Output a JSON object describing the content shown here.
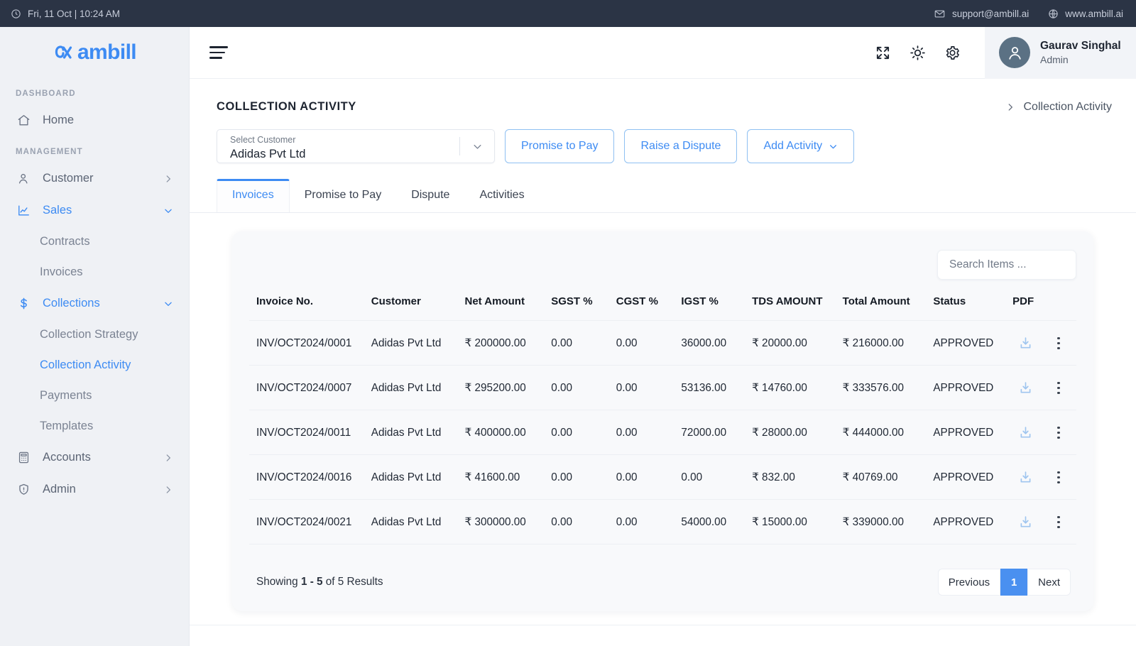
{
  "topbar": {
    "clock_icon": "clock-icon",
    "datetime": "Fri, 11 Oct | 10:24 AM",
    "email_icon": "mail-icon",
    "email": "support@ambill.ai",
    "globe_icon": "globe-icon",
    "website": "www.ambill.ai"
  },
  "brand": {
    "logo_text": "ambill",
    "logo_color": "#3d8bf3"
  },
  "sidebar": {
    "sections": [
      {
        "label": "DASHBOARD"
      },
      {
        "label": "MANAGEMENT"
      }
    ],
    "dashboard_items": [
      {
        "label": "Home",
        "icon": "home-icon",
        "active": false,
        "chevron": ""
      }
    ],
    "management_items": [
      {
        "label": "Customer",
        "icon": "users-icon",
        "active": false,
        "chevron": "chevron-right-icon"
      },
      {
        "label": "Sales",
        "icon": "chart-line-icon",
        "active": true,
        "chevron": "chevron-down-icon"
      },
      {
        "label": "Contracts",
        "sub": true,
        "active": false
      },
      {
        "label": "Invoices",
        "sub": true,
        "active": false
      },
      {
        "label": "Collections",
        "icon": "dollar-icon",
        "active": true,
        "chevron": "chevron-down-icon"
      },
      {
        "label": "Collection Strategy",
        "sub": true,
        "active": false
      },
      {
        "label": "Collection Activity",
        "sub": true,
        "active": true
      },
      {
        "label": "Payments",
        "sub": true,
        "active": false
      },
      {
        "label": "Templates",
        "sub": true,
        "active": false
      },
      {
        "label": "Accounts",
        "icon": "calculator-icon",
        "active": false,
        "chevron": "chevron-right-icon"
      },
      {
        "label": "Admin",
        "icon": "shield-icon",
        "active": false,
        "chevron": "chevron-right-icon"
      }
    ]
  },
  "appbar": {
    "menu_icon": "hamburger-icon",
    "fullscreen_icon": "expand-icon",
    "theme_icon": "sun-icon",
    "settings_icon": "gear-icon",
    "avatar_icon": "user-avatar-icon",
    "user_name": "Gaurav Singhal",
    "user_role": "Admin"
  },
  "page": {
    "title": "COLLECTION ACTIVITY",
    "breadcrumb_icon": "chevron-right-icon",
    "breadcrumb": "Collection Activity"
  },
  "controls": {
    "select_label": "Select Customer",
    "select_value": "Adidas Pvt Ltd",
    "select_caret_icon": "chevron-down-icon",
    "buttons": [
      {
        "label": "Promise to Pay",
        "caret": false
      },
      {
        "label": "Raise a Dispute",
        "caret": false
      },
      {
        "label": "Add Activity",
        "caret": true
      }
    ]
  },
  "tabs": [
    {
      "label": "Invoices",
      "active": true
    },
    {
      "label": "Promise to Pay",
      "active": false
    },
    {
      "label": "Dispute",
      "active": false
    },
    {
      "label": "Activities",
      "active": false
    }
  ],
  "table": {
    "search_placeholder": "Search Items ...",
    "columns": [
      "Invoice No.",
      "Customer",
      "Net Amount",
      "SGST %",
      "CGST %",
      "IGST %",
      "TDS AMOUNT",
      "Total Amount",
      "Status",
      "PDF"
    ],
    "rows": [
      {
        "invoice_no": "INV/OCT2024/0001",
        "customer": "Adidas Pvt Ltd",
        "net_amount": "₹ 200000.00",
        "sgst": "0.00",
        "cgst": "0.00",
        "igst": "36000.00",
        "tds_amount": "₹ 20000.00",
        "total_amount": "₹ 216000.00",
        "status": "APPROVED",
        "download_icon": "download-icon",
        "menu_icon": "kebab-menu-icon"
      },
      {
        "invoice_no": "INV/OCT2024/0007",
        "customer": "Adidas Pvt Ltd",
        "net_amount": "₹ 295200.00",
        "sgst": "0.00",
        "cgst": "0.00",
        "igst": "53136.00",
        "tds_amount": "₹ 14760.00",
        "total_amount": "₹ 333576.00",
        "status": "APPROVED",
        "download_icon": "download-icon",
        "menu_icon": "kebab-menu-icon"
      },
      {
        "invoice_no": "INV/OCT2024/0011",
        "customer": "Adidas Pvt Ltd",
        "net_amount": "₹ 400000.00",
        "sgst": "0.00",
        "cgst": "0.00",
        "igst": "72000.00",
        "tds_amount": "₹ 28000.00",
        "total_amount": "₹ 444000.00",
        "status": "APPROVED",
        "download_icon": "download-icon",
        "menu_icon": "kebab-menu-icon"
      },
      {
        "invoice_no": "INV/OCT2024/0016",
        "customer": "Adidas Pvt Ltd",
        "net_amount": "₹ 41600.00",
        "sgst": "0.00",
        "cgst": "0.00",
        "igst": "0.00",
        "tds_amount": "₹ 832.00",
        "total_amount": "₹ 40769.00",
        "status": "APPROVED",
        "download_icon": "download-icon",
        "menu_icon": "kebab-menu-icon"
      },
      {
        "invoice_no": "INV/OCT2024/0021",
        "customer": "Adidas Pvt Ltd",
        "net_amount": "₹ 300000.00",
        "sgst": "0.00",
        "cgst": "0.00",
        "igst": "54000.00",
        "tds_amount": "₹ 15000.00",
        "total_amount": "₹ 339000.00",
        "status": "APPROVED",
        "download_icon": "download-icon",
        "menu_icon": "kebab-menu-icon"
      }
    ]
  },
  "footer": {
    "showing_prefix": "Showing ",
    "showing_range": "1 - 5",
    "showing_suffix": " of 5 Results",
    "previous_label": "Previous",
    "current_page": "1",
    "next_label": "Next"
  },
  "colors": {
    "accent": "#3d8bf3",
    "pager_active": "#4a90f0",
    "topbar_bg": "#2b3445",
    "sidebar_bg": "#eff1f5",
    "card_bg": "#f8f9fb"
  }
}
